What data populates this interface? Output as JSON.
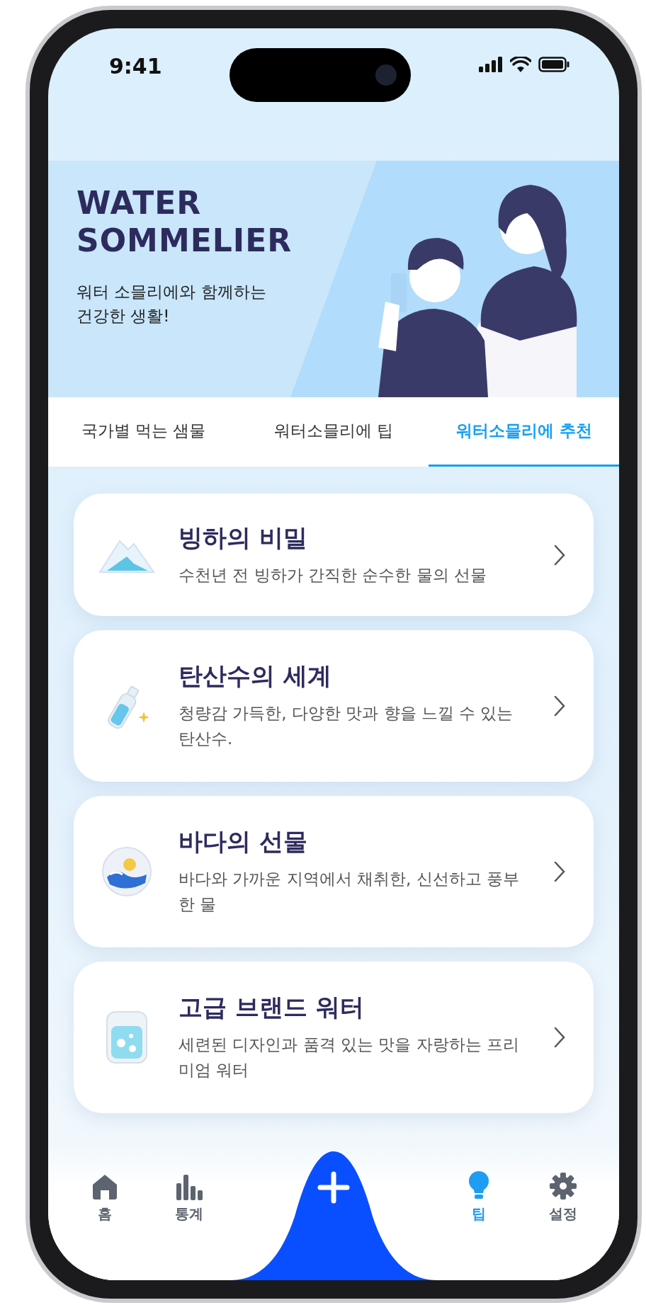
{
  "status_bar": {
    "time": "9:41"
  },
  "banner": {
    "title_lines": [
      "WATER",
      "SOMMELIER"
    ],
    "subtitle_lines": [
      "워터 소믈리에와 함께하는",
      "건강한 생활!"
    ]
  },
  "tabs": [
    {
      "label": "국가별 먹는 샘물",
      "selected": false
    },
    {
      "label": "워터소믈리에 팁",
      "selected": false
    },
    {
      "label": "워터소믈리에 추천",
      "selected": true
    }
  ],
  "cards": [
    {
      "kind": "glacier",
      "title": "빙하의 비밀",
      "description": "수천년 전 빙하가 간직한 순수한 물의 선물"
    },
    {
      "kind": "sparkling",
      "title": "탄산수의 세계",
      "description": "청량감 가득한, 다양한 맛과 향을 느낄 수 있는 탄산수."
    },
    {
      "kind": "sea",
      "title": "바다의 선물",
      "description": "바다와 가까운 지역에서 채취한, 신선하고 풍부한 물"
    },
    {
      "kind": "premium",
      "title": "고급 브랜드 워터",
      "description": "세련된 디자인과 품격 있는 맛을 자랑하는 프리미엄 워터"
    }
  ],
  "nav": [
    {
      "kind": "home",
      "label": "홈",
      "selected": false
    },
    {
      "kind": "stats",
      "label": "통계",
      "selected": false
    },
    {
      "kind": "add"
    },
    {
      "kind": "tips",
      "label": "팁",
      "selected": true
    },
    {
      "kind": "settings",
      "label": "설정",
      "selected": false
    }
  ]
}
